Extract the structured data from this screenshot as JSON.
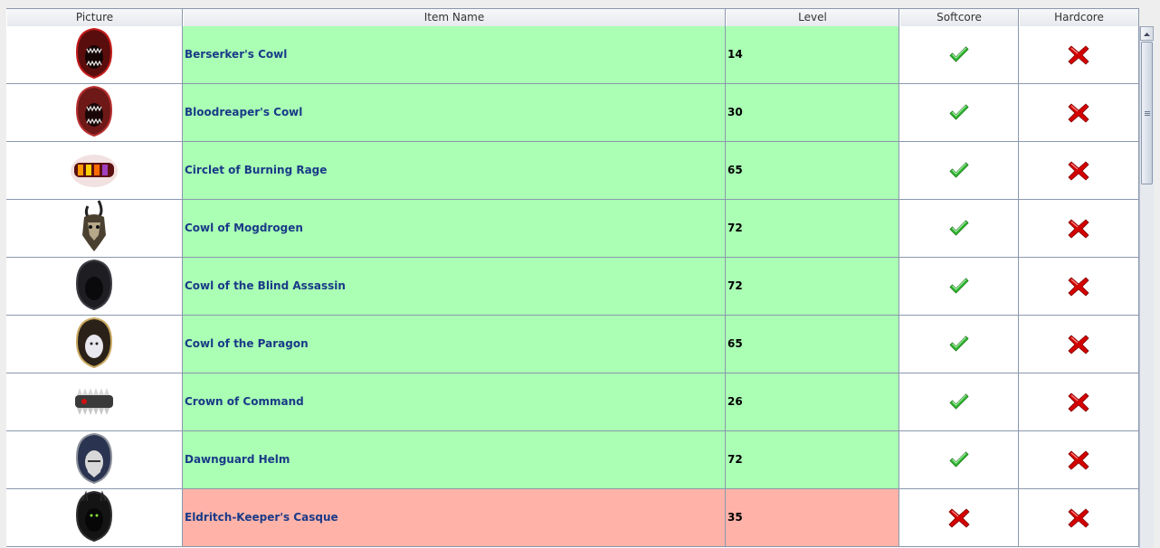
{
  "columns": [
    "Picture",
    "Item Name",
    "Level",
    "Softcore",
    "Hardcore"
  ],
  "colors": {
    "available_row": "#aaffb4",
    "unavailable_row": "#ffb3a8",
    "check": "#2eb82e",
    "cross": "#d40000"
  },
  "rows": [
    {
      "icon": "berserkers-cowl-icon",
      "name": "Berserker's Cowl",
      "level": "14",
      "softcore": true,
      "hardcore": false
    },
    {
      "icon": "bloodreapers-cowl-icon",
      "name": "Bloodreaper's Cowl",
      "level": "30",
      "softcore": true,
      "hardcore": false
    },
    {
      "icon": "circlet-of-burning-rage-icon",
      "name": "Circlet of Burning Rage",
      "level": "65",
      "softcore": true,
      "hardcore": false
    },
    {
      "icon": "cowl-of-mogdrogen-icon",
      "name": "Cowl of Mogdrogen",
      "level": "72",
      "softcore": true,
      "hardcore": false
    },
    {
      "icon": "cowl-of-the-blind-assassin-icon",
      "name": "Cowl of the Blind Assassin",
      "level": "72",
      "softcore": true,
      "hardcore": false
    },
    {
      "icon": "cowl-of-the-paragon-icon",
      "name": "Cowl of the Paragon",
      "level": "65",
      "softcore": true,
      "hardcore": false
    },
    {
      "icon": "crown-of-command-icon",
      "name": "Crown of Command",
      "level": "26",
      "softcore": true,
      "hardcore": false
    },
    {
      "icon": "dawnguard-helm-icon",
      "name": "Dawnguard Helm",
      "level": "72",
      "softcore": true,
      "hardcore": false
    },
    {
      "icon": "eldritch-keepers-casque-icon",
      "name": "Eldritch-Keeper's Casque",
      "level": "35",
      "softcore": false,
      "hardcore": false
    }
  ]
}
